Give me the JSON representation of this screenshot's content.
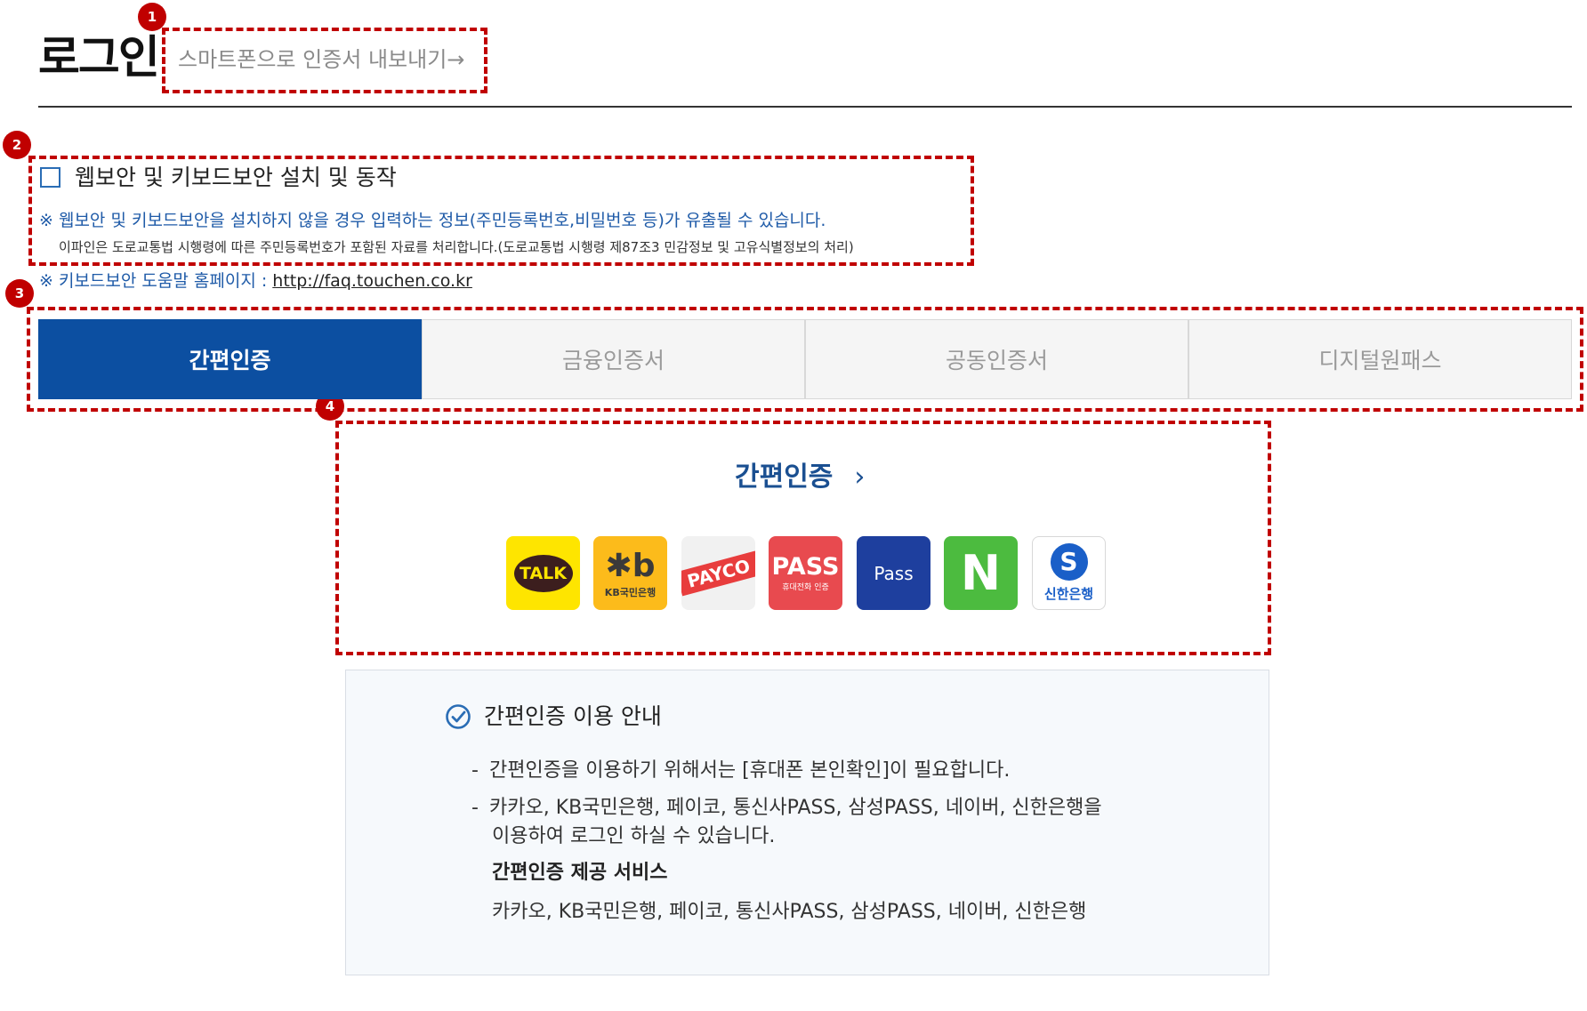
{
  "header": {
    "title": "로그인",
    "export_link": "스마트폰으로 인증서 내보내기→"
  },
  "markers": [
    "1",
    "2",
    "3",
    "4"
  ],
  "security": {
    "checkbox_label": "웹보안 및 키보드보안 설치 및 동작",
    "checked": false,
    "warning": "※ 웹보안 및 키보드보안을 설치하지 않을 경우 입력하는 정보(주민등록번호,비밀번호 등)가 유출될 수 있습니다.",
    "notice": "이파인은 도로교통법 시행령에 따른 주민등록번호가 포함된 자료를 처리합니다.(도로교통법 시행령 제87조3 민감정보 및 고유식별정보의 처리)",
    "help_prefix": "※ 키보드보안 도움말 홈페이지 : ",
    "help_url": "http://faq.touchen.co.kr"
  },
  "tabs": [
    {
      "label": "간편인증",
      "active": true
    },
    {
      "label": "금융인증서",
      "active": false
    },
    {
      "label": "공동인증서",
      "active": false
    },
    {
      "label": "디지털원패스",
      "active": false
    }
  ],
  "easy_auth": {
    "heading": "간편인증",
    "chevron": "›",
    "providers": [
      {
        "name": "kakao-icon",
        "text": "TALK",
        "color": "#fee500"
      },
      {
        "name": "kb-icon",
        "mark": "✱b",
        "text": "KB국민은행",
        "color": "#fcbb1b"
      },
      {
        "name": "payco-icon",
        "text": "PAYCO",
        "color": "#e83d3d"
      },
      {
        "name": "pass-telecom-icon",
        "text": "PASS",
        "sub": "휴대전화 인증",
        "color": "#e84a4f"
      },
      {
        "name": "samsung-pass-icon",
        "text": "Pass",
        "color": "#1e3f9e"
      },
      {
        "name": "naver-icon",
        "text": "N",
        "color": "#4cbb3f"
      },
      {
        "name": "shinhan-icon",
        "mark": "S",
        "text": "신한은행",
        "color": "#1a5fc8"
      }
    ]
  },
  "guide": {
    "title": "간편인증 이용 안내",
    "bullet": "-",
    "items": [
      "간편인증을 이용하기 위해서는 [휴대폰 본인확인]이 필요합니다.",
      "카카오, KB국민은행, 페이코, 통신사PASS, 삼성PASS, 네이버, 신한은행을",
      "이용하여 로그인 하실 수 있습니다."
    ],
    "service_title": "간편인증 제공 서비스",
    "service_list": "카카오, KB국민은행, 페이코, 통신사PASS, 삼성PASS, 네이버, 신한은행"
  }
}
